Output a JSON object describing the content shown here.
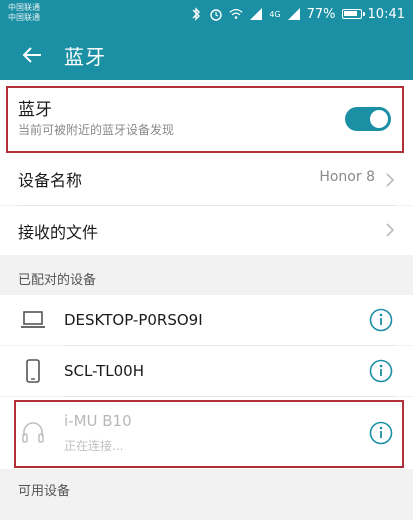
{
  "status_bar": {
    "carrier_1": "中国联通",
    "carrier_2": "中国联通",
    "signal_text": "4G",
    "battery": "77%",
    "time": "10:41"
  },
  "header": {
    "title": "蓝牙"
  },
  "bluetooth": {
    "label": "蓝牙",
    "subtitle": "当前可被附近的蓝牙设备发现",
    "enabled": true
  },
  "settings": [
    {
      "label": "设备名称",
      "value": "Honor 8"
    },
    {
      "label": "接收的文件",
      "value": ""
    }
  ],
  "paired_section": {
    "title": "已配对的设备",
    "devices": [
      {
        "name": "DESKTOP-P0RSO9I",
        "icon": "laptop-icon",
        "status": ""
      },
      {
        "name": "SCL-TL00H",
        "icon": "phone-icon",
        "status": ""
      },
      {
        "name": "i-MU B10",
        "icon": "headphones-icon",
        "status": "正在连接..."
      }
    ]
  },
  "available_section": {
    "title": "可用设备"
  },
  "colors": {
    "accent": "#1b8fa4",
    "highlight_box": "#b0303a"
  }
}
